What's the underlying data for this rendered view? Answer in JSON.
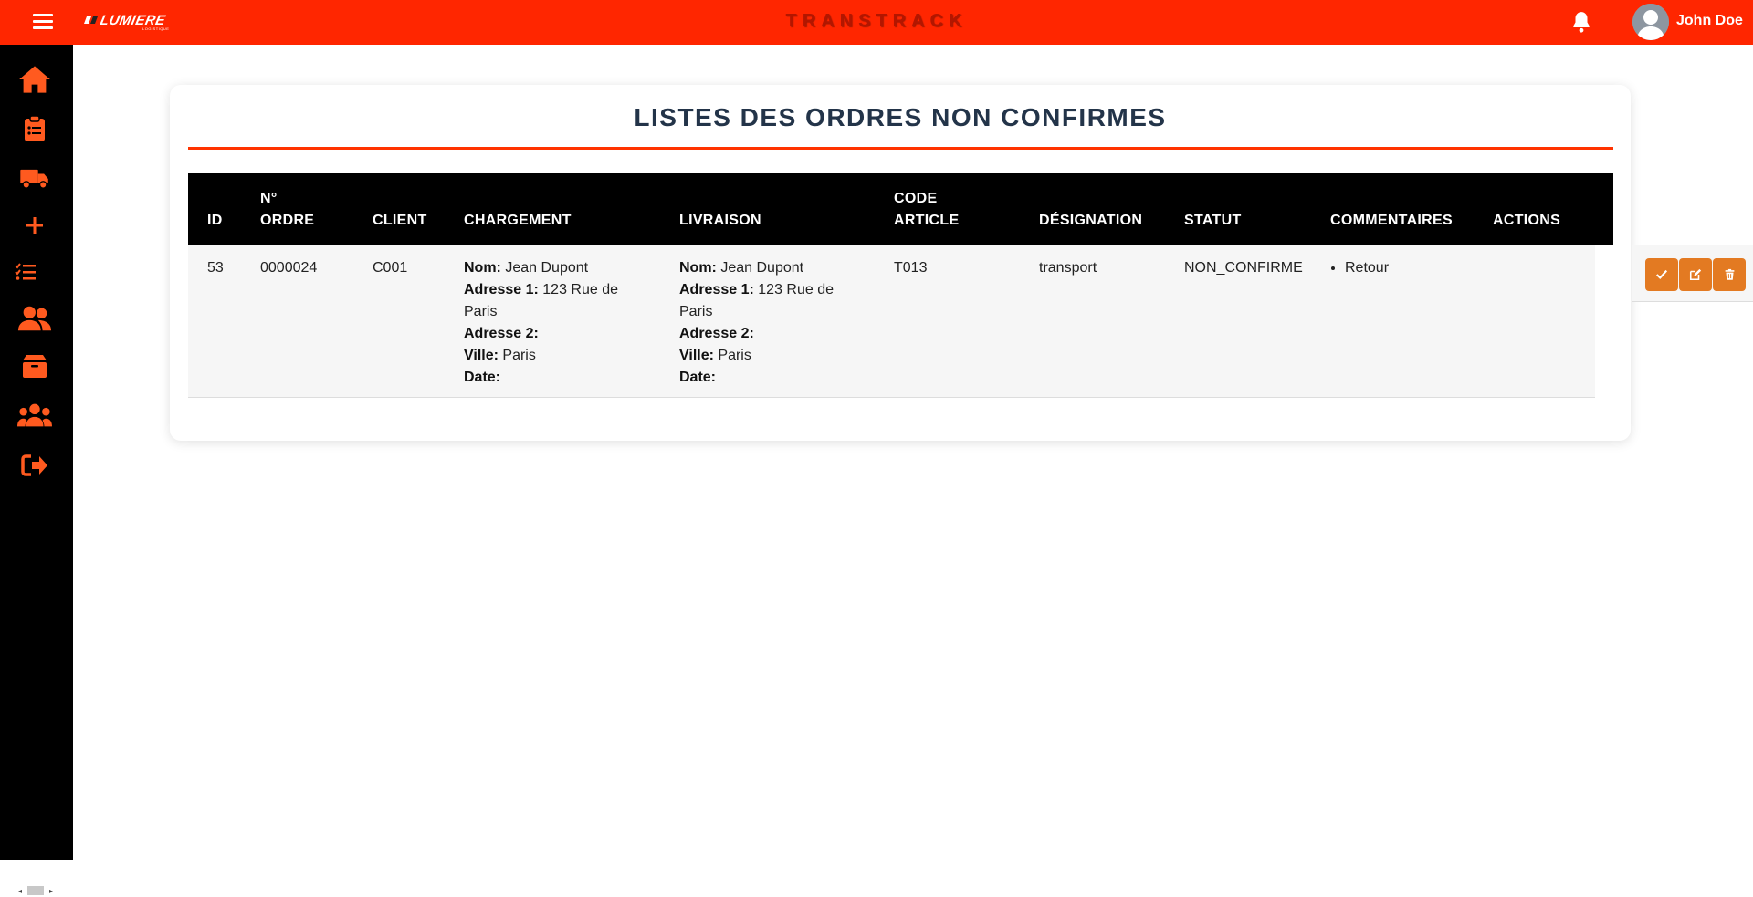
{
  "header": {
    "brand": "TRANSTRACK",
    "logo_text": "LUMIERE",
    "logo_sub": "LOGISTIQUE",
    "user_name": "John Doe",
    "accent_color": "#ff2600"
  },
  "sidebar": {
    "icons": [
      "home-icon",
      "clipboard-list-icon",
      "truck-icon",
      "plus-icon",
      "tasks-list-icon",
      "users-icon",
      "box-icon",
      "group-icon",
      "sign-out-icon"
    ],
    "icon_color": "#ff5a1f"
  },
  "page": {
    "title": "LISTES DES ORDRES NON CONFIRMES"
  },
  "table": {
    "headers": {
      "id": "ID",
      "order_line1": "N°",
      "order_line2": "ORDRE",
      "client": "CLIENT",
      "chargement": "CHARGEMENT",
      "livraison": "LIVRAISON",
      "code_line1": "CODE",
      "code_line2": "ARTICLE",
      "designation": "DÉSIGNATION",
      "statut": "STATUT",
      "commentaires": "COMMENTAIRES",
      "actions": "ACTIONS"
    },
    "labels": {
      "nom": "Nom:",
      "adresse1": "Adresse 1:",
      "adresse2": "Adresse 2:",
      "ville": "Ville:",
      "date": "Date:"
    },
    "rows": [
      {
        "id": "53",
        "order_number": "0000024",
        "client": "C001",
        "chargement": {
          "nom": "Jean Dupont",
          "adresse1": "123 Rue de Paris",
          "adresse2": "",
          "ville": "Paris",
          "date": ""
        },
        "livraison": {
          "nom": "Jean Dupont",
          "adresse1": "123 Rue de Paris",
          "adresse2": "",
          "ville": "Paris",
          "date": ""
        },
        "code_article": "T013",
        "designation": "transport",
        "statut": "NON_CONFIRME",
        "commentaires": [
          "Retour"
        ],
        "action_color": "#e37a22"
      }
    ]
  }
}
